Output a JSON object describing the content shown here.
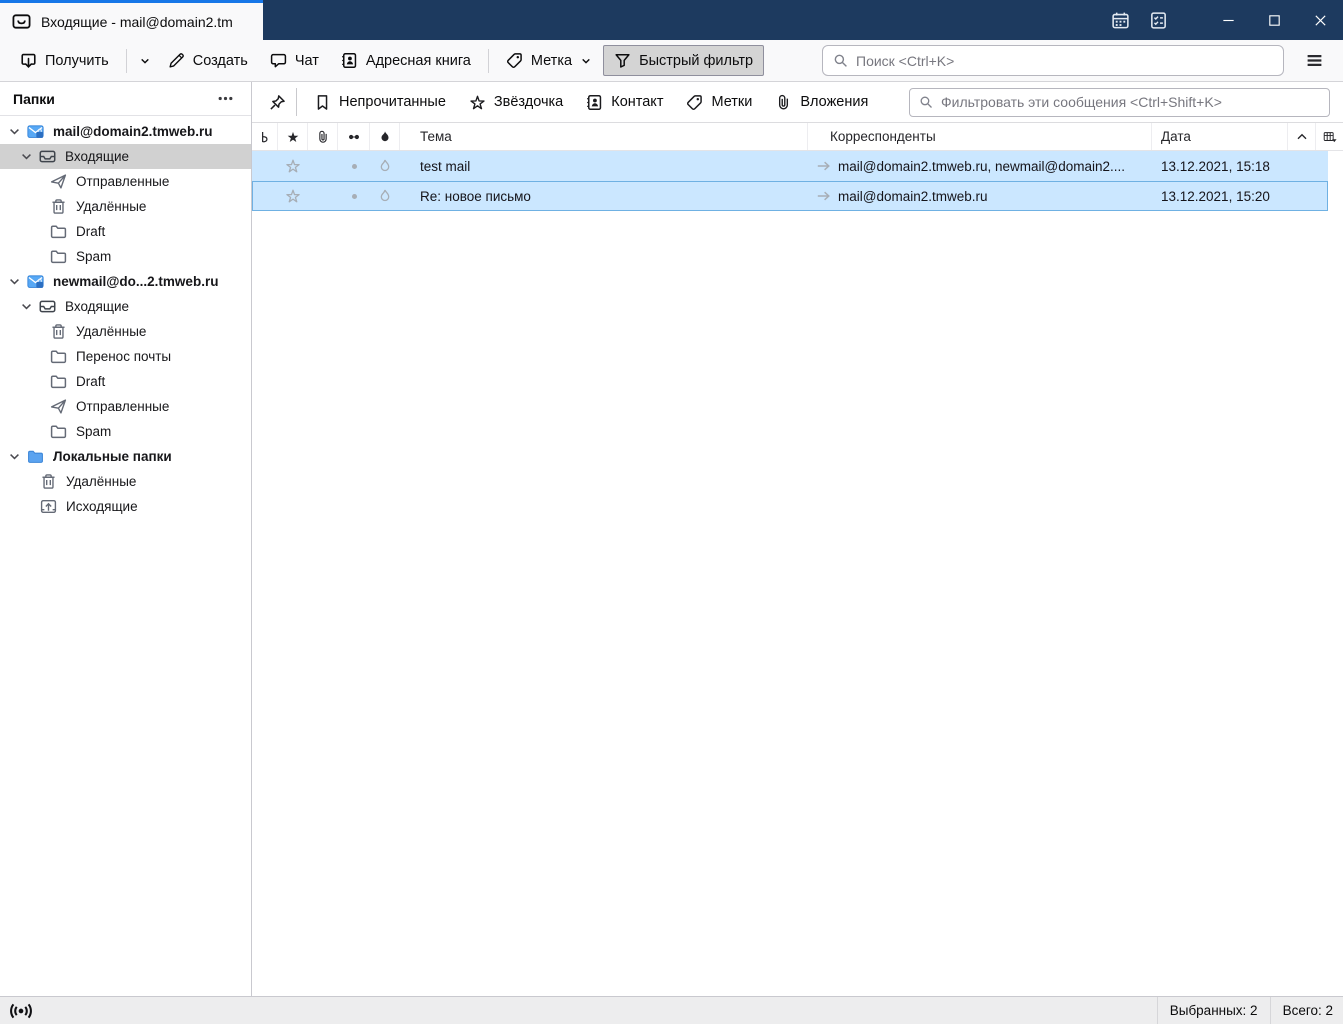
{
  "window": {
    "tab_title": "Входящие - mail@domain2.tm"
  },
  "toolbar": {
    "get_label": "Получить",
    "write_label": "Создать",
    "chat_label": "Чат",
    "address_book_label": "Адресная книга",
    "tag_label": "Метка",
    "quick_filter_label": "Быстрый фильтр",
    "search_placeholder": "Поиск <Ctrl+K>"
  },
  "quick_filter": {
    "unread_label": "Непрочитанные",
    "starred_label": "Звёздочка",
    "contact_label": "Контакт",
    "tags_label": "Метки",
    "attachment_label": "Вложения",
    "input_placeholder": "Фильтровать эти сообщения <Ctrl+Shift+K>"
  },
  "folder_pane": {
    "title": "Папки",
    "items": [
      {
        "label": "mail@domain2.tmweb.ru"
      },
      {
        "label": "Входящие"
      },
      {
        "label": "Отправленные"
      },
      {
        "label": "Удалённые"
      },
      {
        "label": "Draft"
      },
      {
        "label": "Spam"
      },
      {
        "label": "newmail@do...2.tmweb.ru"
      },
      {
        "label": "Входящие"
      },
      {
        "label": "Удалённые"
      },
      {
        "label": "Перенос почты"
      },
      {
        "label": "Draft"
      },
      {
        "label": "Отправленные"
      },
      {
        "label": "Spam"
      },
      {
        "label": "Локальные папки"
      },
      {
        "label": "Удалённые"
      },
      {
        "label": "Исходящие"
      }
    ]
  },
  "message_list": {
    "columns": {
      "subject": "Тема",
      "correspondents": "Корреспонденты",
      "date": "Дата"
    },
    "rows": [
      {
        "subject": "test mail",
        "correspondents": "mail@domain2.tmweb.ru, newmail@domain2....",
        "date": "13.12.2021, 15:18"
      },
      {
        "subject": "Re: новое письмо",
        "correspondents": "mail@domain2.tmweb.ru",
        "date": "13.12.2021, 15:20"
      }
    ]
  },
  "status_bar": {
    "selected_label": "Выбранных: 2",
    "total_label": "Всего: 2"
  },
  "colors": {
    "titlebar": "#1d3a5f",
    "tab_accent": "#1777e8",
    "toolbar_bg": "#f9f9fa",
    "row_selected": "#cbe7ff",
    "row_focus_border": "#6fb1e3",
    "folder_selected": "#d1d1d1",
    "pressed_button": "#d4d4d4",
    "statusbar_bg": "#ededee",
    "account_icon_blue": "#57a8f5"
  }
}
